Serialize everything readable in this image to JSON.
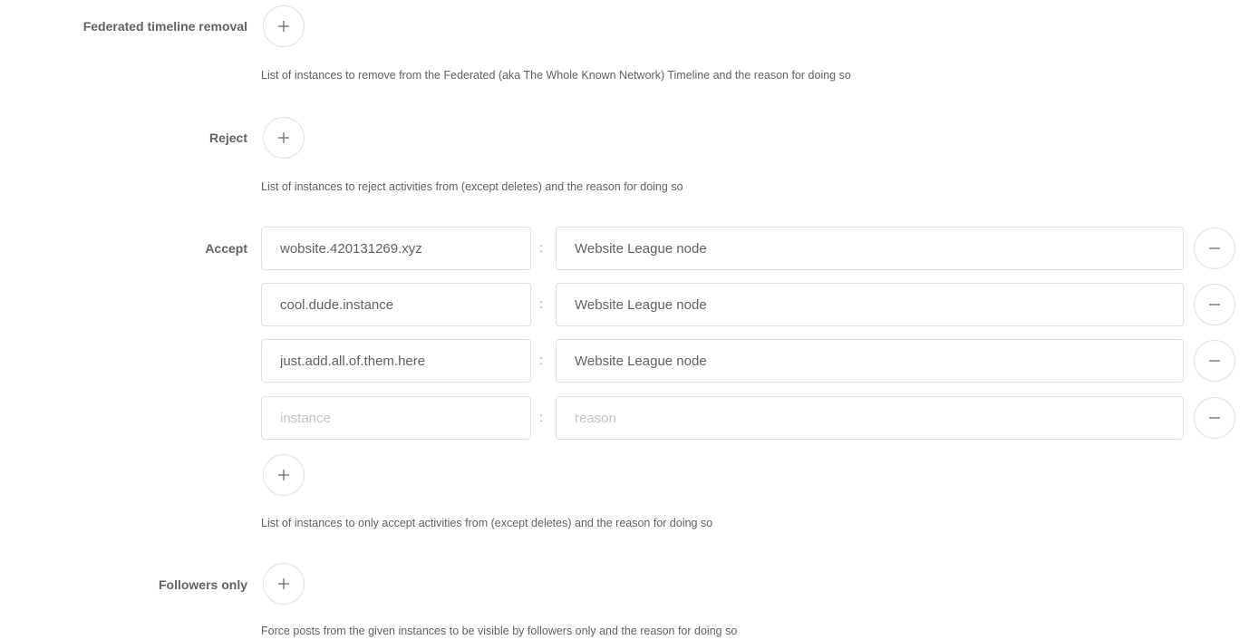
{
  "sections": {
    "federated": {
      "label": "Federated timeline removal",
      "description": "List of instances to remove from the Federated (aka The Whole Known Network) Timeline and the reason for doing so"
    },
    "reject": {
      "label": "Reject",
      "description": "List of instances to reject activities from (except deletes) and the reason for doing so"
    },
    "accept": {
      "label": "Accept",
      "separator": ":",
      "rows": [
        {
          "instance": "wobsite.420131269.xyz",
          "reason": "Website League node"
        },
        {
          "instance": "cool.dude.instance",
          "reason": "Website League node"
        },
        {
          "instance": "just.add.all.of.them.here",
          "reason": "Website League node"
        },
        {
          "instance": "",
          "reason": ""
        }
      ],
      "instance_placeholder": "instance",
      "reason_placeholder": "reason",
      "description": "List of instances to only accept activities from (except deletes) and the reason for doing so"
    },
    "followers_only": {
      "label": "Followers only",
      "description": "Force posts from the given instances to be visible by followers only and the reason for doing so"
    }
  },
  "icons": {
    "add": "plus-icon",
    "remove": "minus-icon"
  },
  "colors": {
    "text": "#606266",
    "border": "#dcdfe6",
    "placeholder": "#c0c4cc"
  }
}
